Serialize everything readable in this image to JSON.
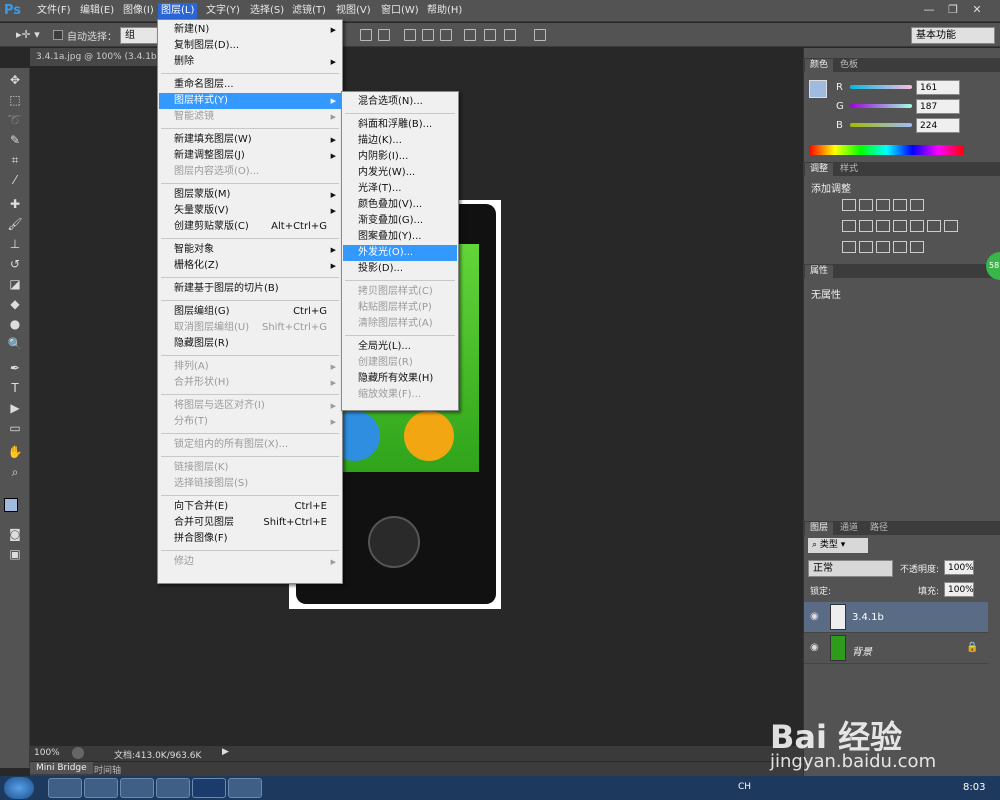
{
  "app": {
    "logo": "Ps"
  },
  "menubar": [
    "文件(F)",
    "编辑(E)",
    "图像(I)",
    "图层(L)",
    "文字(Y)",
    "选择(S)",
    "滤镜(T)",
    "视图(V)",
    "窗口(W)",
    "帮助(H)"
  ],
  "options": {
    "auto_select": "自动选择：",
    "auto_select_value": "组",
    "workspace": "基本功能"
  },
  "doc_tab": "3.4.1a.jpg @ 100% (3.4.1b,",
  "status": {
    "zoom": "100%",
    "doc_info": "文档:413.0K/963.6K"
  },
  "bottom_tabs": [
    "Mini Bridge",
    "时间轴"
  ],
  "color_panel": {
    "tabs": [
      "颜色",
      "色板"
    ],
    "channels": [
      {
        "label": "R",
        "value": "161"
      },
      {
        "label": "G",
        "value": "187"
      },
      {
        "label": "B",
        "value": "224"
      }
    ],
    "fg_color": "#a1bbe0"
  },
  "adjust_panel": {
    "tabs": [
      "调整",
      "样式"
    ],
    "title": "添加调整"
  },
  "props_panel": {
    "tab": "属性",
    "text": "无属性"
  },
  "layers_panel": {
    "tabs": [
      "图层",
      "通道",
      "路径"
    ],
    "kind": "类型",
    "blend": "正常",
    "opacity_label": "不透明度:",
    "opacity": "100%",
    "lock_label": "锁定:",
    "fill_label": "填充:",
    "fill": "100%",
    "layers": [
      {
        "name": "3.4.1b"
      },
      {
        "name": "背景"
      }
    ]
  },
  "badge": "58",
  "layer_menu": [
    {
      "label": "新建(N)",
      "arrow": true
    },
    {
      "label": "复制图层(D)..."
    },
    {
      "label": "删除",
      "arrow": true
    },
    {
      "sep": true
    },
    {
      "label": "重命名图层..."
    },
    {
      "label": "图层样式(Y)",
      "arrow": true,
      "hl": true
    },
    {
      "label": "智能滤镜",
      "arrow": true,
      "dis": true
    },
    {
      "sep": true
    },
    {
      "label": "新建填充图层(W)",
      "arrow": true
    },
    {
      "label": "新建调整图层(J)",
      "arrow": true
    },
    {
      "label": "图层内容选项(O)...",
      "dis": true
    },
    {
      "sep": true
    },
    {
      "label": "图层蒙版(M)",
      "arrow": true
    },
    {
      "label": "矢量蒙版(V)",
      "arrow": true
    },
    {
      "label": "创建剪贴蒙版(C)",
      "sc": "Alt+Ctrl+G"
    },
    {
      "sep": true
    },
    {
      "label": "智能对象",
      "arrow": true
    },
    {
      "label": "栅格化(Z)",
      "arrow": true
    },
    {
      "sep": true
    },
    {
      "label": "新建基于图层的切片(B)"
    },
    {
      "sep": true
    },
    {
      "label": "图层编组(G)",
      "sc": "Ctrl+G"
    },
    {
      "label": "取消图层编组(U)",
      "sc": "Shift+Ctrl+G",
      "dis": true
    },
    {
      "label": "隐藏图层(R)"
    },
    {
      "sep": true
    },
    {
      "label": "排列(A)",
      "arrow": true,
      "dis": true
    },
    {
      "label": "合并形状(H)",
      "arrow": true,
      "dis": true
    },
    {
      "sep": true
    },
    {
      "label": "将图层与选区对齐(I)",
      "arrow": true,
      "dis": true
    },
    {
      "label": "分布(T)",
      "arrow": true,
      "dis": true
    },
    {
      "sep": true
    },
    {
      "label": "锁定组内的所有图层(X)...",
      "dis": true
    },
    {
      "sep": true
    },
    {
      "label": "链接图层(K)",
      "dis": true
    },
    {
      "label": "选择链接图层(S)",
      "dis": true
    },
    {
      "sep": true
    },
    {
      "label": "向下合并(E)",
      "sc": "Ctrl+E"
    },
    {
      "label": "合并可见图层",
      "sc": "Shift+Ctrl+E"
    },
    {
      "label": "拼合图像(F)"
    },
    {
      "sep": true
    },
    {
      "label": "修边",
      "arrow": true,
      "dis": true
    }
  ],
  "style_menu": [
    {
      "label": "混合选项(N)..."
    },
    {
      "sep": true
    },
    {
      "label": "斜面和浮雕(B)..."
    },
    {
      "label": "描边(K)..."
    },
    {
      "label": "内阴影(I)..."
    },
    {
      "label": "内发光(W)..."
    },
    {
      "label": "光泽(T)..."
    },
    {
      "label": "颜色叠加(V)..."
    },
    {
      "label": "渐变叠加(G)..."
    },
    {
      "label": "图案叠加(Y)..."
    },
    {
      "label": "外发光(O)...",
      "hl": true
    },
    {
      "label": "投影(D)..."
    },
    {
      "sep": true
    },
    {
      "label": "拷贝图层样式(C)",
      "dis": true
    },
    {
      "label": "粘贴图层样式(P)",
      "dis": true
    },
    {
      "label": "清除图层样式(A)",
      "dis": true
    },
    {
      "sep": true
    },
    {
      "label": "全局光(L)..."
    },
    {
      "label": "创建图层(R)",
      "dis": true
    },
    {
      "label": "隐藏所有效果(H)"
    },
    {
      "label": "缩放效果(F)...",
      "dis": true
    }
  ],
  "taskbar": {
    "lang": "CH",
    "time": "8:03"
  },
  "watermark": {
    "brand": "Bai  经验",
    "url": "jingyan.baidu.com"
  }
}
